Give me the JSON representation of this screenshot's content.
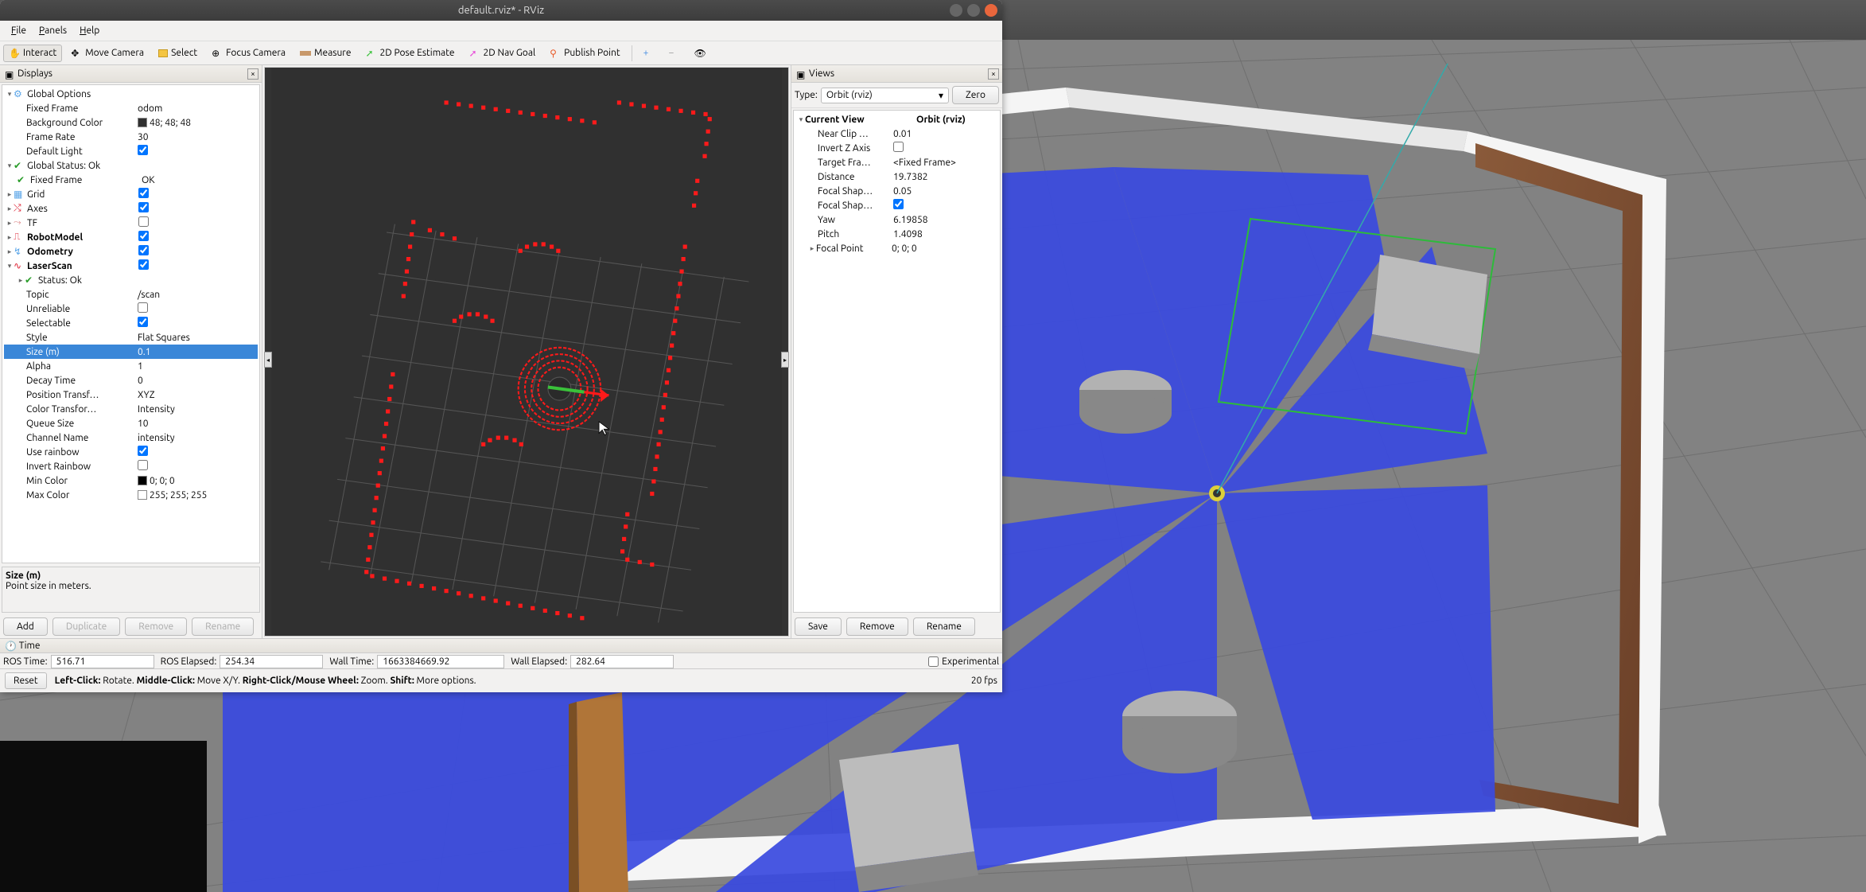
{
  "window": {
    "title": "default.rviz* - RViz"
  },
  "menubar": [
    "File",
    "Panels",
    "Help"
  ],
  "toolbar": {
    "interact": "Interact",
    "move_camera": "Move Camera",
    "select": "Select",
    "focus_camera": "Focus Camera",
    "measure": "Measure",
    "pose_estimate": "2D Pose Estimate",
    "nav_goal": "2D Nav Goal",
    "publish_point": "Publish Point"
  },
  "displays": {
    "title": "Displays",
    "global_options": {
      "label": "Global Options",
      "fixed_frame": {
        "label": "Fixed Frame",
        "value": "odom"
      },
      "background_color": {
        "label": "Background Color",
        "value": "48; 48; 48",
        "swatch": "#303030"
      },
      "frame_rate": {
        "label": "Frame Rate",
        "value": "30"
      },
      "default_light": {
        "label": "Default Light",
        "checked": true
      }
    },
    "global_status": {
      "label": "Global Status: Ok",
      "fixed_frame": {
        "label": "Fixed Frame",
        "value": "OK"
      }
    },
    "grid": {
      "label": "Grid",
      "checked": true
    },
    "axes": {
      "label": "Axes",
      "checked": true
    },
    "tf": {
      "label": "TF",
      "checked": false
    },
    "robot_model": {
      "label": "RobotModel",
      "checked": true
    },
    "odometry": {
      "label": "Odometry",
      "checked": true
    },
    "laserscan": {
      "label": "LaserScan",
      "checked": true,
      "status": {
        "label": "Status: Ok"
      },
      "topic": {
        "label": "Topic",
        "value": "/scan"
      },
      "unreliable": {
        "label": "Unreliable",
        "checked": false
      },
      "selectable": {
        "label": "Selectable",
        "checked": true
      },
      "style": {
        "label": "Style",
        "value": "Flat Squares"
      },
      "size": {
        "label": "Size (m)",
        "value": "0.1"
      },
      "alpha": {
        "label": "Alpha",
        "value": "1"
      },
      "decay_time": {
        "label": "Decay Time",
        "value": "0"
      },
      "position_transf": {
        "label": "Position Transf…",
        "value": "XYZ"
      },
      "color_transf": {
        "label": "Color Transfor…",
        "value": "Intensity"
      },
      "queue_size": {
        "label": "Queue Size",
        "value": "10"
      },
      "channel_name": {
        "label": "Channel Name",
        "value": "intensity"
      },
      "use_rainbow": {
        "label": "Use rainbow",
        "checked": true
      },
      "invert_rainbow": {
        "label": "Invert Rainbow",
        "checked": false
      },
      "min_color": {
        "label": "Min Color",
        "value": "0; 0; 0",
        "swatch": "#000000"
      },
      "max_color": {
        "label": "Max Color",
        "value": "255; 255; 255",
        "swatch": "#ffffff"
      }
    },
    "help": {
      "title": "Size (m)",
      "text": "Point size in meters."
    },
    "buttons": {
      "add": "Add",
      "duplicate": "Duplicate",
      "remove": "Remove",
      "rename": "Rename"
    }
  },
  "views": {
    "title": "Views",
    "type_label": "Type:",
    "type_value": "Orbit (rviz)",
    "zero": "Zero",
    "current_view": {
      "label": "Current View",
      "value": "Orbit (rviz)"
    },
    "near_clip": {
      "label": "Near Clip …",
      "value": "0.01"
    },
    "invert_z": {
      "label": "Invert Z Axis",
      "checked": false
    },
    "target_frame": {
      "label": "Target Fra…",
      "value": "<Fixed Frame>"
    },
    "distance": {
      "label": "Distance",
      "value": "19.7382"
    },
    "focal_shape_size": {
      "label": "Focal Shap…",
      "value": "0.05"
    },
    "focal_shape_fixed": {
      "label": "Focal Shap…",
      "checked": true
    },
    "yaw": {
      "label": "Yaw",
      "value": "6.19858"
    },
    "pitch": {
      "label": "Pitch",
      "value": "1.4098"
    },
    "focal_point": {
      "label": "Focal Point",
      "value": "0; 0; 0"
    },
    "buttons": {
      "save": "Save",
      "remove": "Remove",
      "rename": "Rename"
    }
  },
  "time": {
    "title": "Time",
    "ros_time": {
      "label": "ROS Time:",
      "value": "516.71"
    },
    "ros_elapsed": {
      "label": "ROS Elapsed:",
      "value": "254.34"
    },
    "wall_time": {
      "label": "Wall Time:",
      "value": "1663384669.92"
    },
    "wall_elapsed": {
      "label": "Wall Elapsed:",
      "value": "282.64"
    },
    "experimental": "Experimental"
  },
  "status": {
    "reset": "Reset",
    "hints": "Left-Click: Rotate. Middle-Click: Move X/Y. Right-Click/Mouse Wheel: Zoom. Shift: More options.",
    "fps": "20 fps"
  }
}
